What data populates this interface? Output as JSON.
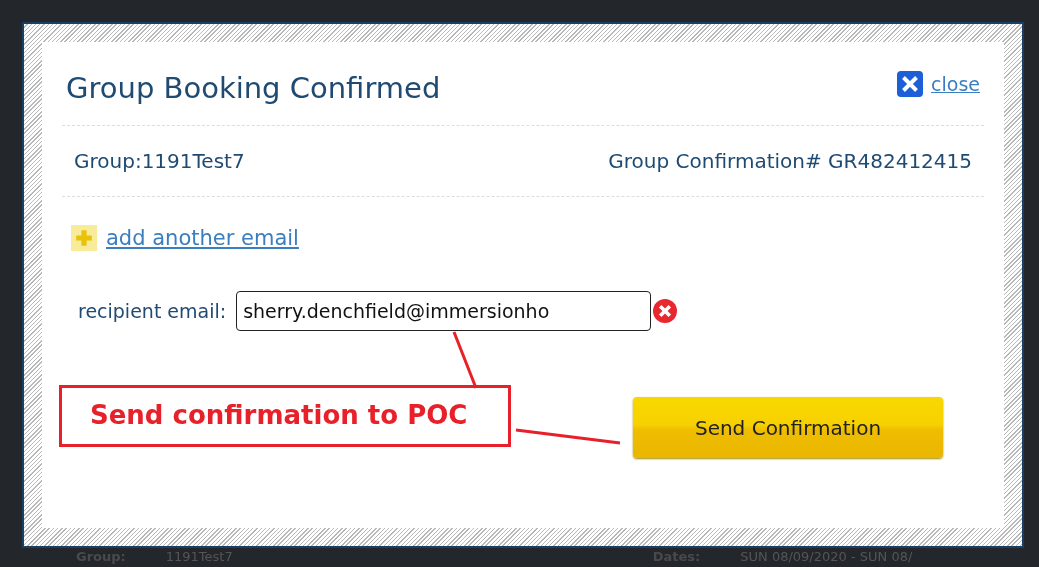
{
  "dialog": {
    "title": "Group Booking Confirmed",
    "close_link": "close",
    "group": "Group:1191Test7",
    "confirmation": "Group Confirmation# GR482412415",
    "add_email_link": "add another email",
    "recipient_label": "recipient email:",
    "recipient_value": "sherry.denchfield@immersionho",
    "send_button": "Send Confirmation"
  },
  "annotation": {
    "text": "Send confirmation to POC"
  },
  "background_page": {
    "group_label": "Group:",
    "group_value": "1191Test7",
    "dates_label": "Dates:",
    "dates_value": "SUN 08/09/2020 - SUN 08/"
  }
}
